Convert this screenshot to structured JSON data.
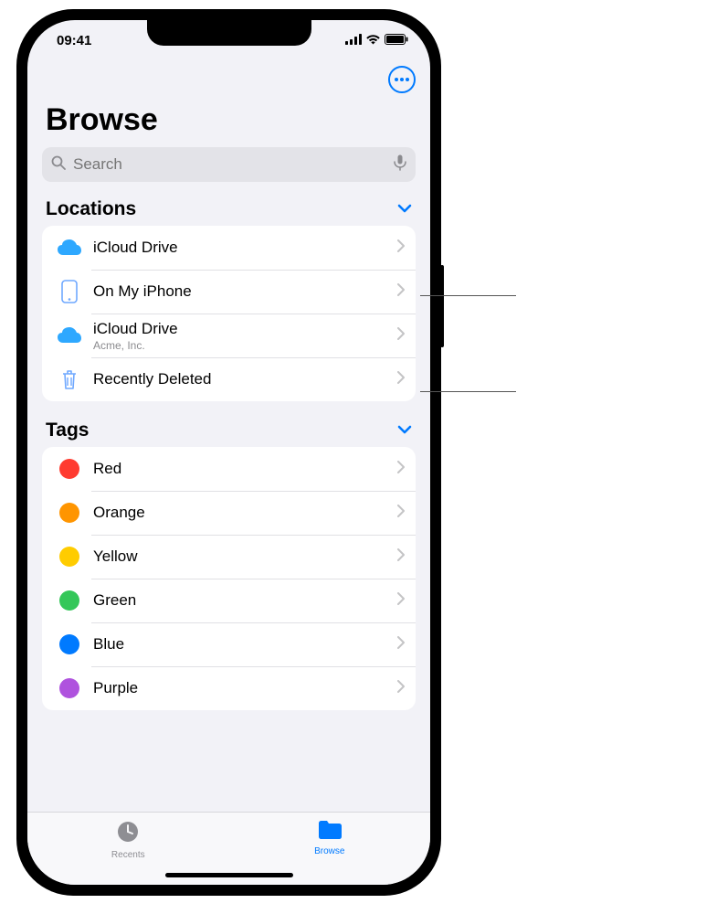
{
  "status": {
    "time": "09:41"
  },
  "page": {
    "title": "Browse"
  },
  "search": {
    "placeholder": "Search"
  },
  "sections": {
    "locations": {
      "title": "Locations",
      "items": [
        {
          "label": "iCloud Drive",
          "sub": "",
          "icon": "icloud"
        },
        {
          "label": "On My iPhone",
          "sub": "",
          "icon": "iphone"
        },
        {
          "label": "iCloud Drive",
          "sub": "Acme, Inc.",
          "icon": "icloud"
        },
        {
          "label": "Recently Deleted",
          "sub": "",
          "icon": "trash"
        }
      ]
    },
    "tags": {
      "title": "Tags",
      "items": [
        {
          "label": "Red",
          "color": "#ff3b30"
        },
        {
          "label": "Orange",
          "color": "#ff9500"
        },
        {
          "label": "Yellow",
          "color": "#ffcc00"
        },
        {
          "label": "Green",
          "color": "#34c759"
        },
        {
          "label": "Blue",
          "color": "#007aff"
        },
        {
          "label": "Purple",
          "color": "#af52de"
        }
      ]
    }
  },
  "tabs": {
    "recents": "Recents",
    "browse": "Browse"
  }
}
